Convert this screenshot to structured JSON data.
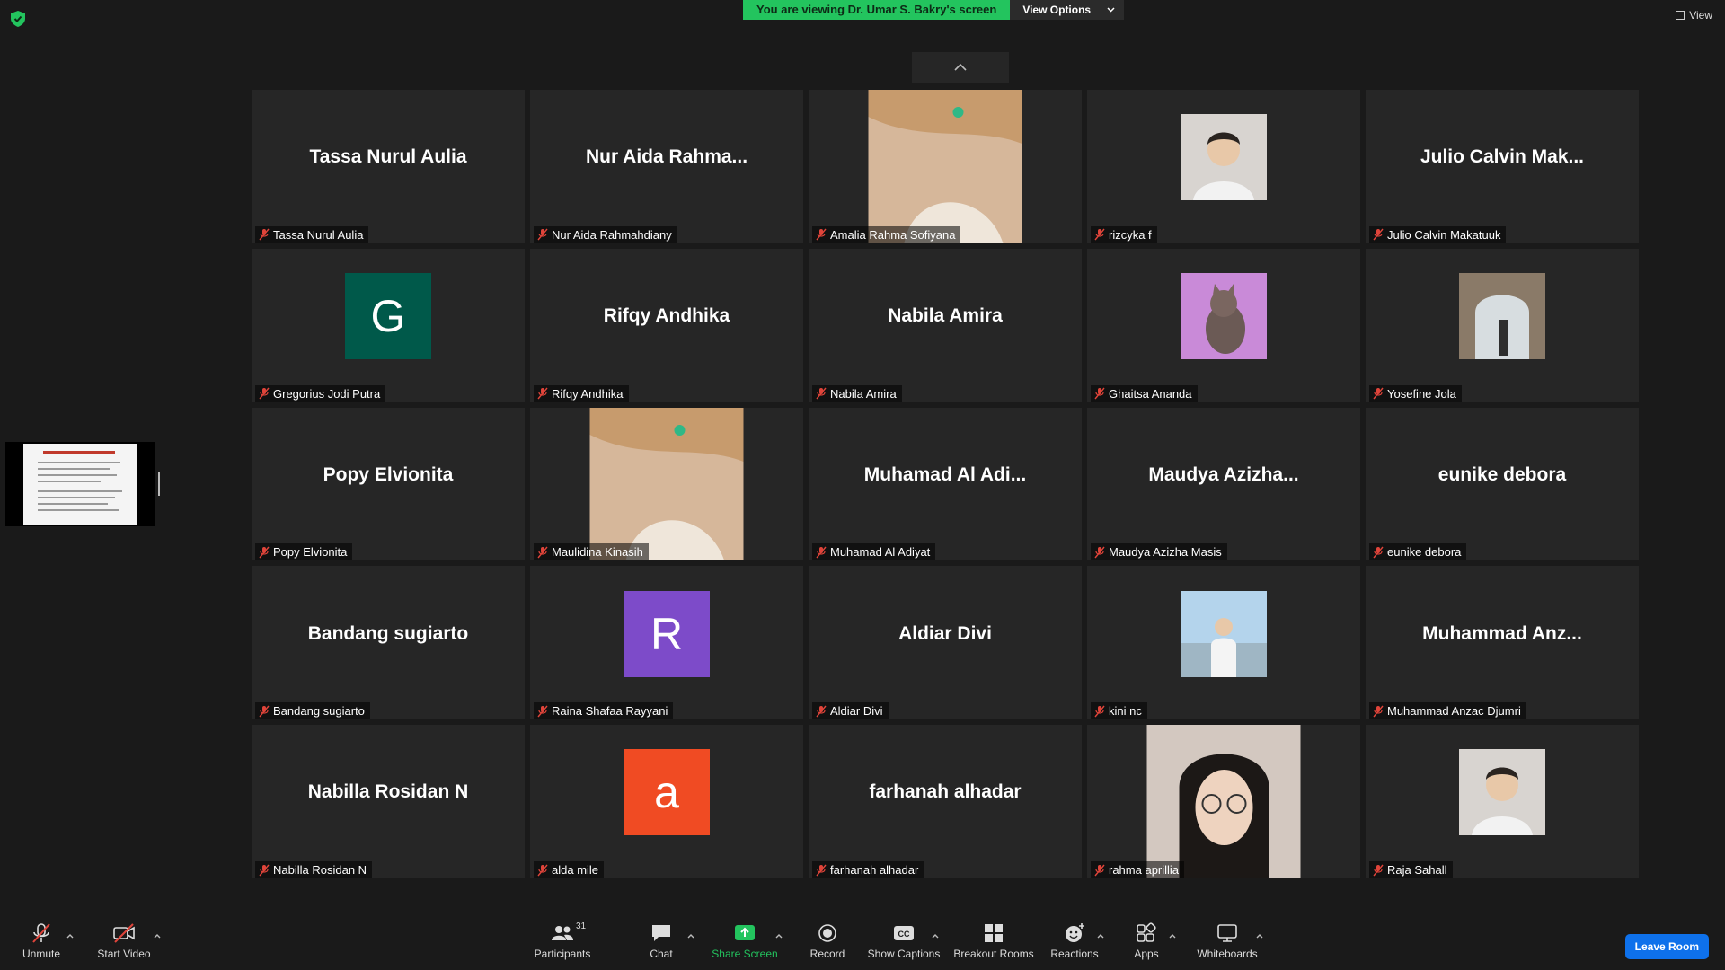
{
  "banner": {
    "viewing_text": "You are viewing Dr. Umar S. Bakry's screen",
    "options_label": "View Options"
  },
  "view_label": "View",
  "participants": [
    {
      "display": "Tassa Nurul Aulia",
      "name": "Tassa Nurul Aulia"
    },
    {
      "display": "Nur Aida Rahma...",
      "name": "Nur Aida Rahmahdiany"
    },
    {
      "name": "Amalia Rahma Sofiyana",
      "video": "anime-video"
    },
    {
      "name": "rizcyka f",
      "thumb": "profile-photo"
    },
    {
      "display": "Julio Calvin Mak...",
      "name": "Julio Calvin Makatuuk"
    },
    {
      "name": "Gregorius Jodi Putra",
      "initial": "G",
      "color": "#00594a"
    },
    {
      "display": "Rifqy Andhika",
      "name": "Rifqy Andhika"
    },
    {
      "display": "Nabila Amira",
      "name": "Nabila Amira"
    },
    {
      "name": "Ghaitsa Ananda",
      "thumb": "cat-photo"
    },
    {
      "name": "Yosefine Jola",
      "thumb": "arch-photo"
    },
    {
      "display": "Popy Elvionita",
      "name": "Popy Elvionita"
    },
    {
      "name": "Maulidina Kinasih",
      "video": "anime-video"
    },
    {
      "display": "Muhamad Al Adi...",
      "name": "Muhamad Al Adiyat"
    },
    {
      "display": "Maudya Azizha...",
      "name": "Maudya Azizha Masis"
    },
    {
      "display": "eunike debora",
      "name": "eunike debora"
    },
    {
      "display": "Bandang sugiarto",
      "name": "Bandang sugiarto"
    },
    {
      "name": "Raina Shafaa Rayyani",
      "initial": "R",
      "color": "#7d4bc9"
    },
    {
      "display": "Aldiar Divi",
      "name": "Aldiar Divi"
    },
    {
      "name": "kini nc",
      "thumb": "beach-photo"
    },
    {
      "display": "Muhammad Anz...",
      "name": "Muhammad Anzac Djumri"
    },
    {
      "display": "Nabilla Rosidan N",
      "name": "Nabilla Rosidan N"
    },
    {
      "name": "alda mile",
      "initial": "a",
      "color": "#f04b23"
    },
    {
      "display": "farhanah alhadar",
      "name": "farhanah alhadar"
    },
    {
      "name": "rahma aprillia",
      "video": "webcam-video"
    },
    {
      "name": "Raja Sahall",
      "thumb": "profile-photo"
    }
  ],
  "toolbar": {
    "unmute": "Unmute",
    "start_video": "Start Video",
    "participants": "Participants",
    "participant_count": "31",
    "chat": "Chat",
    "share_screen": "Share Screen",
    "record": "Record",
    "show_captions": "Show Captions",
    "breakout_rooms": "Breakout Rooms",
    "reactions": "Reactions",
    "apps": "Apps",
    "whiteboards": "Whiteboards",
    "leave": "Leave Room",
    "captions_icon_text": "CC"
  },
  "colors": {
    "accent_green": "#23c45e",
    "leave_blue": "#0e71eb",
    "tile_bg": "#262626",
    "muted_red": "#e0443a"
  }
}
